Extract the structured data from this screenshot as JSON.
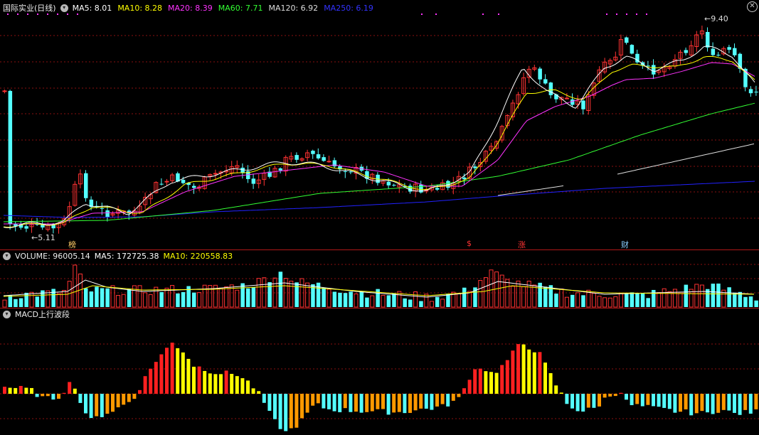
{
  "main_chart": {
    "title": "国际实业(日线)",
    "ma_labels": [
      {
        "text": "MA5: 8.01",
        "color": "#ffffff"
      },
      {
        "text": "MA10: 8.28",
        "color": "#ffff00"
      },
      {
        "text": "MA20: 8.39",
        "color": "#ff33ff"
      },
      {
        "text": "MA60: 7.71",
        "color": "#33ff33"
      },
      {
        "text": "MA120: 6.92",
        "color": "#dddddd"
      },
      {
        "text": "MA250: 6.19",
        "color": "#3333ff"
      }
    ],
    "high_label": "9.40",
    "low_label": "5.11",
    "event_labels": [
      "榜",
      "$",
      "涨",
      "财"
    ]
  },
  "volume_chart": {
    "title": "VOLUME: 96005.14",
    "ma5": "MA5: 172725.38",
    "ma10": "MA10: 220558.83"
  },
  "macd_chart": {
    "title": "MACD上行波段"
  },
  "colors": {
    "up": "#ff3232",
    "down": "#54ffff",
    "border": "#b01818",
    "grid": "#8a1010",
    "macd_red": "#ff2020",
    "macd_yellow": "#ffff00",
    "macd_orange": "#ff9900",
    "macd_cyan": "#54ffff"
  },
  "chart_data": {
    "type": "candlestick",
    "key_prices": {
      "high": 9.4,
      "low": 5.11
    },
    "moving_averages": {
      "MA5": 8.01,
      "MA10": 8.28,
      "MA20": 8.39,
      "MA60": 7.71,
      "MA120": 6.92,
      "MA250": 6.19
    },
    "volume": {
      "last": 96005.14,
      "MA5": 172725.38,
      "MA10": 220558.83
    }
  }
}
